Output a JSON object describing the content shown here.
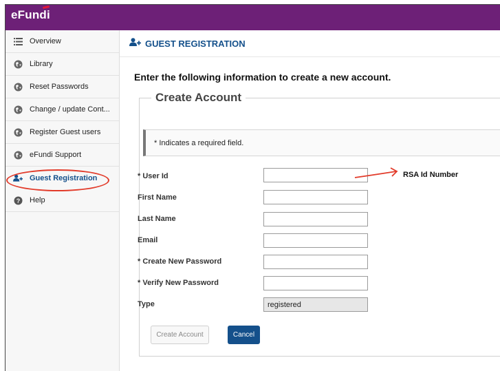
{
  "app": {
    "logo_text": "eFundi",
    "brand_color": "#6d2077",
    "accent_color": "#14508b",
    "annotation_color": "#e23b2a"
  },
  "sidebar": {
    "items": [
      {
        "label": "Overview",
        "icon": "list-icon"
      },
      {
        "label": "Library",
        "icon": "globe-icon"
      },
      {
        "label": "Reset Passwords",
        "icon": "globe-icon"
      },
      {
        "label": "Change / update Cont...",
        "icon": "globe-icon"
      },
      {
        "label": "Register Guest users",
        "icon": "globe-icon"
      },
      {
        "label": "eFundi Support",
        "icon": "globe-icon"
      },
      {
        "label": "Guest Registration",
        "icon": "user-plus-icon",
        "active": true
      },
      {
        "label": "Help",
        "icon": "question-icon"
      }
    ]
  },
  "page": {
    "header": "GUEST REGISTRATION",
    "instruction": "Enter the following information to create a new account.",
    "legend": "Create Account",
    "required_notice": "* Indicates a required field."
  },
  "form": {
    "fields": [
      {
        "label": "* User Id",
        "value": ""
      },
      {
        "label": "First Name",
        "value": ""
      },
      {
        "label": "Last Name",
        "value": ""
      },
      {
        "label": "Email",
        "value": ""
      },
      {
        "label": "* Create New Password",
        "value": ""
      },
      {
        "label": "* Verify New Password",
        "value": ""
      },
      {
        "label": "Type",
        "value": "registered"
      }
    ],
    "annotation_note": "RSA Id Number",
    "create_button": "Create Account",
    "cancel_button": "Cancel"
  }
}
